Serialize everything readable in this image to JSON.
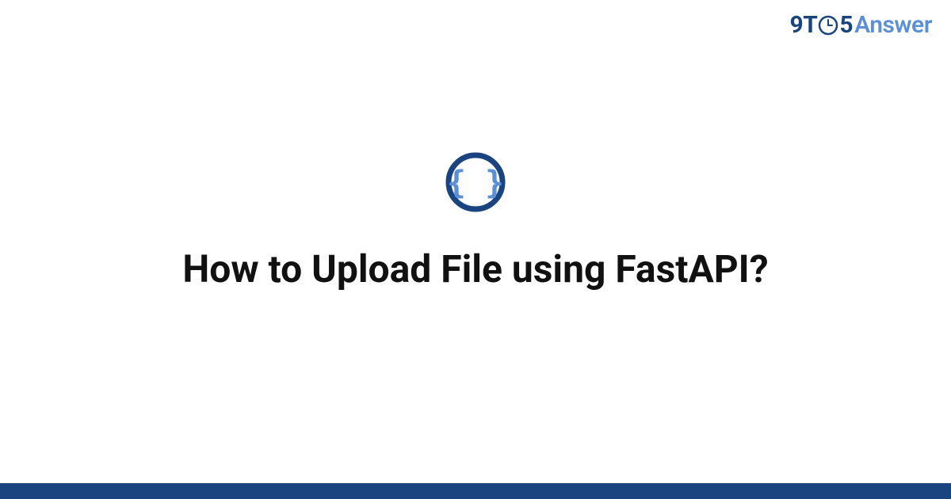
{
  "logo": {
    "part1": "9T",
    "part2": "5",
    "part3": "Answer"
  },
  "title": "How to Upload File using FastAPI?",
  "colors": {
    "dark_blue": "#1a4480",
    "light_blue": "#5b8fd6",
    "accent_bar": "#1a4480"
  }
}
